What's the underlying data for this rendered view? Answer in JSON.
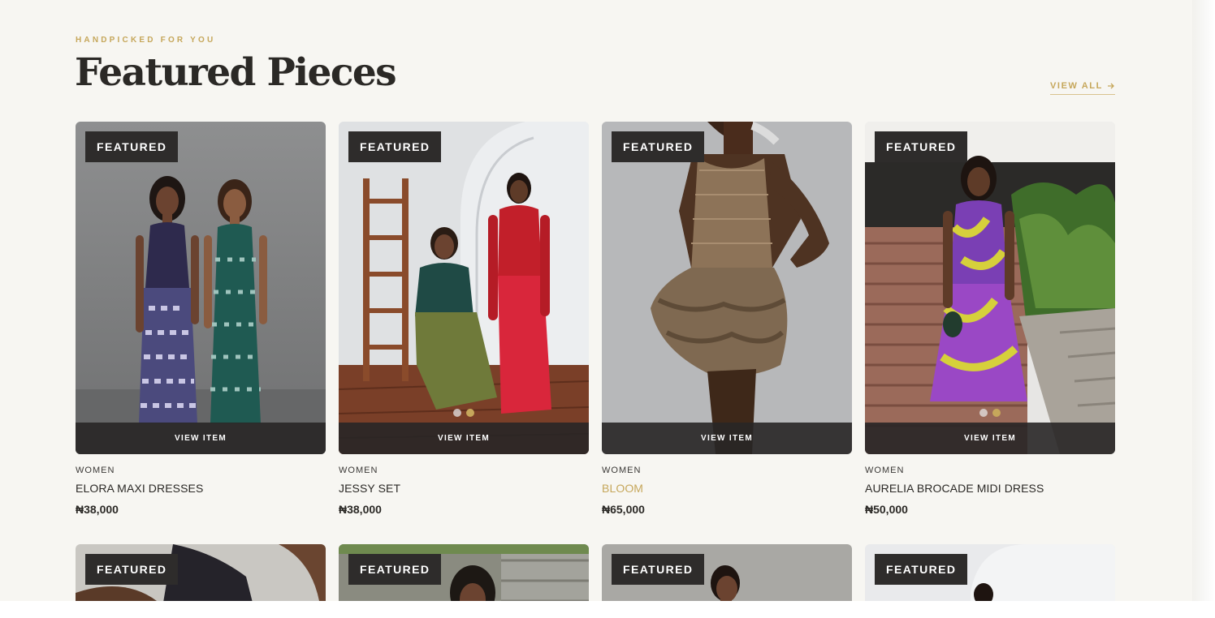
{
  "section": {
    "eyebrow": "HANDPICKED FOR YOU",
    "title": "Featured Pieces",
    "view_all": "VIEW ALL",
    "view_all_icon": "arrow-right-icon"
  },
  "colors": {
    "accent": "#c6a75b",
    "background": "#f7f6f2",
    "badge": "#2e2c2b",
    "text": "#2b2926"
  },
  "products": [
    {
      "badge": "FEATURED",
      "cta": "VIEW ITEM",
      "category": "WOMEN",
      "name": "ELORA MAXI DRESSES",
      "price": "₦38,000",
      "carousel_dots": 0,
      "name_highlighted": false
    },
    {
      "badge": "FEATURED",
      "cta": "VIEW ITEM",
      "category": "WOMEN",
      "name": "JESSY SET",
      "price": "₦38,000",
      "carousel_dots": 2,
      "name_highlighted": false
    },
    {
      "badge": "FEATURED",
      "cta": "VIEW ITEM",
      "category": "WOMEN",
      "name": "BLOOM",
      "price": "₦65,000",
      "carousel_dots": 0,
      "name_highlighted": true
    },
    {
      "badge": "FEATURED",
      "cta": "VIEW ITEM",
      "category": "WOMEN",
      "name": "AURELIA BROCADE MIDI DRESS",
      "price": "₦50,000",
      "carousel_dots": 2,
      "name_highlighted": false
    }
  ],
  "products_row2": [
    {
      "badge": "FEATURED"
    },
    {
      "badge": "FEATURED"
    },
    {
      "badge": "FEATURED"
    },
    {
      "badge": "FEATURED"
    }
  ]
}
